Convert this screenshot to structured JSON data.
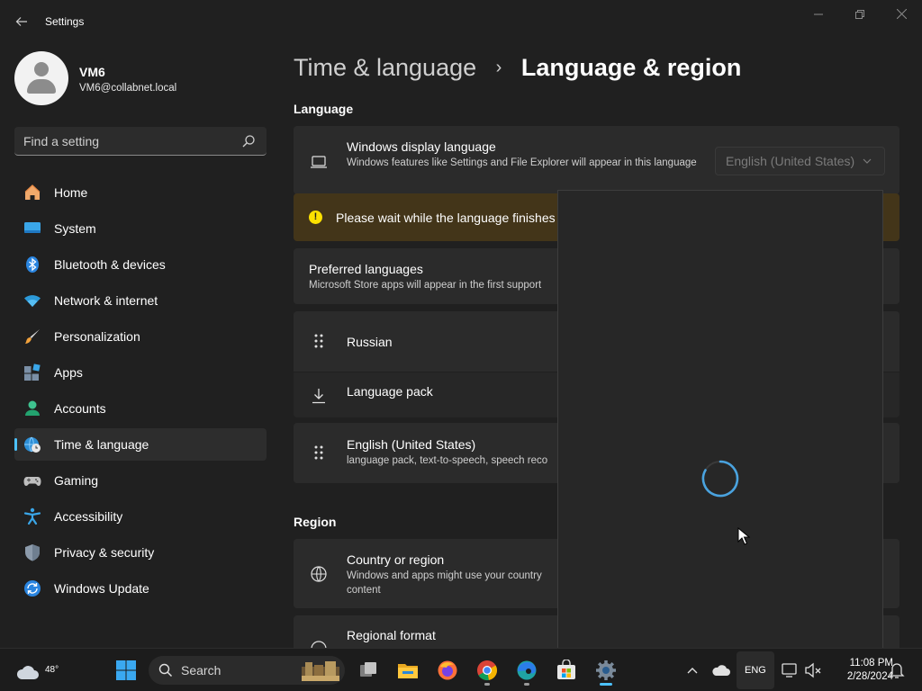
{
  "app": {
    "title": "Settings",
    "back_icon": "arrow-left-icon",
    "minimize": "—",
    "maximize": "❐",
    "close": "✕"
  },
  "user": {
    "name": "VM6",
    "email": "VM6@collabnet.local"
  },
  "search": {
    "placeholder": "Find a setting",
    "icon": "search-icon"
  },
  "sidebar": {
    "items": [
      {
        "label": "Home",
        "icon": "home-icon"
      },
      {
        "label": "System",
        "icon": "system-display-icon"
      },
      {
        "label": "Bluetooth & devices",
        "icon": "bluetooth-icon"
      },
      {
        "label": "Network & internet",
        "icon": "wifi-icon"
      },
      {
        "label": "Personalization",
        "icon": "paintbrush-icon"
      },
      {
        "label": "Apps",
        "icon": "apps-icon"
      },
      {
        "label": "Accounts",
        "icon": "accounts-icon"
      },
      {
        "label": "Time & language",
        "icon": "globe-clock-icon",
        "selected": true
      },
      {
        "label": "Gaming",
        "icon": "gamepad-icon"
      },
      {
        "label": "Accessibility",
        "icon": "accessibility-icon"
      },
      {
        "label": "Privacy & security",
        "icon": "shield-icon"
      },
      {
        "label": "Windows Update",
        "icon": "update-icon"
      }
    ]
  },
  "breadcrumb": {
    "parent": "Time & language",
    "separator": "›",
    "current": "Language & region"
  },
  "language_section": {
    "title": "Language",
    "display_language": {
      "title": "Windows display language",
      "description": "Windows features like Settings and File Explorer will appear in this language",
      "dropdown_value": "English (United States)"
    },
    "warning": {
      "text": "Please wait while the language finishes i"
    },
    "preferred": {
      "title": "Preferred languages",
      "description": "Microsoft Store apps will appear in the first support"
    },
    "languages": [
      {
        "name": "Russian",
        "subtitle": ""
      },
      {
        "name": "Language pack",
        "subtitle": ""
      },
      {
        "name": "English (United States)",
        "subtitle": "language pack, text-to-speech, speech reco"
      }
    ]
  },
  "region_section": {
    "title": "Region",
    "country": {
      "title": "Country or region",
      "description_line1": "Windows and apps might use your country",
      "description_line2": "content"
    },
    "regional_format": {
      "title": "Regional format"
    }
  },
  "taskbar": {
    "weather_temp": "48°",
    "search_label": "Search",
    "tray_language": "ENG",
    "time": "11:08 PM",
    "date": "2/28/2024"
  },
  "colors": {
    "accent": "#4cc2ff",
    "warning_bg": "#433519",
    "warning_icon": "#fce100",
    "card_bg": "#2b2b2b",
    "window_bg": "#202020"
  }
}
